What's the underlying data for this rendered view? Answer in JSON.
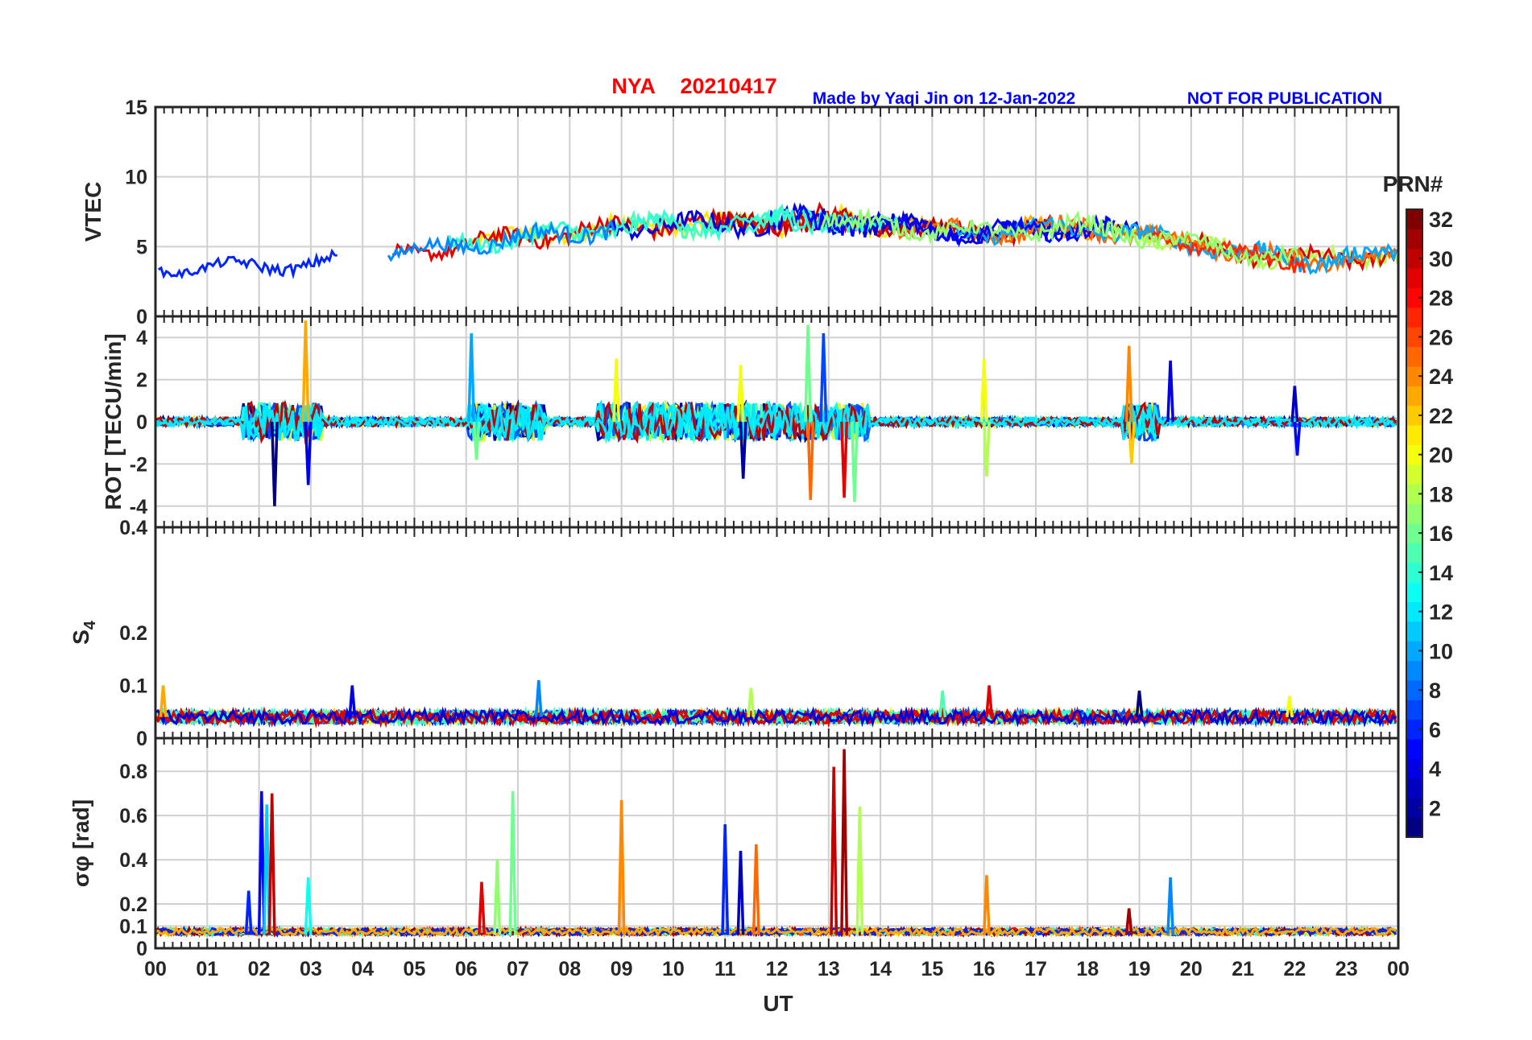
{
  "header": {
    "station": "NYA",
    "date": "20210417",
    "credit": "Made by Yaqi Jin on 12-Jan-2022",
    "notice": "NOT FOR PUBLICATION"
  },
  "x_axis": {
    "label": "UT",
    "ticks": [
      "00",
      "01",
      "02",
      "03",
      "04",
      "05",
      "06",
      "07",
      "08",
      "09",
      "10",
      "11",
      "12",
      "13",
      "14",
      "15",
      "16",
      "17",
      "18",
      "19",
      "20",
      "21",
      "22",
      "23",
      "00"
    ]
  },
  "colorbar": {
    "title": "PRN#",
    "range": [
      1,
      32
    ],
    "ticks": [
      "2",
      "4",
      "6",
      "8",
      "10",
      "12",
      "14",
      "16",
      "18",
      "20",
      "22",
      "24",
      "26",
      "28",
      "30",
      "32"
    ],
    "colormap": "jet"
  },
  "chart_data": [
    {
      "type": "line",
      "panel": "vtec",
      "ylabel": "VTEC",
      "ylim": [
        0,
        15
      ],
      "yticks": [
        "0",
        "5",
        "10",
        "15"
      ],
      "xlim_hours": [
        0,
        24
      ],
      "grid": true,
      "series_envelope": {
        "x_hours": [
          0,
          1,
          2,
          3,
          4,
          5,
          6,
          7,
          8,
          9,
          10,
          11,
          12,
          13,
          14,
          15,
          16,
          17,
          18,
          19,
          20,
          21,
          22,
          23,
          24
        ],
        "mean": [
          3.4,
          3.5,
          3.6,
          3.8,
          4.2,
          4.6,
          5.2,
          5.6,
          6.0,
          6.4,
          6.6,
          6.6,
          6.8,
          6.9,
          6.6,
          6.2,
          6.0,
          6.2,
          6.4,
          5.8,
          5.2,
          4.6,
          4.0,
          4.2,
          4.5
        ],
        "spread": [
          0.6,
          0.6,
          0.8,
          0.8,
          0.8,
          0.8,
          1.0,
          1.2,
          1.2,
          1.2,
          1.2,
          1.3,
          1.4,
          1.6,
          1.2,
          1.0,
          1.0,
          1.2,
          1.3,
          1.2,
          1.0,
          1.0,
          1.2,
          1.2,
          1.2
        ]
      }
    },
    {
      "type": "line",
      "panel": "rot",
      "ylabel": "ROT [TECU/min]",
      "ylim": [
        -5,
        5
      ],
      "yticks": [
        "-4",
        "-2",
        "0",
        "2",
        "4"
      ],
      "xlim_hours": [
        0,
        24
      ],
      "grid": true,
      "spikes": [
        {
          "x": 2.3,
          "y": -4.0
        },
        {
          "x": 2.9,
          "y": 4.8
        },
        {
          "x": 2.95,
          "y": -3.0
        },
        {
          "x": 6.1,
          "y": 4.2
        },
        {
          "x": 6.2,
          "y": -1.8
        },
        {
          "x": 8.9,
          "y": 3.0
        },
        {
          "x": 11.3,
          "y": 2.7
        },
        {
          "x": 11.35,
          "y": -2.7
        },
        {
          "x": 12.6,
          "y": 4.6
        },
        {
          "x": 12.65,
          "y": -3.7
        },
        {
          "x": 12.9,
          "y": 4.2
        },
        {
          "x": 13.3,
          "y": -3.6
        },
        {
          "x": 13.5,
          "y": -3.8
        },
        {
          "x": 16.0,
          "y": 3.0
        },
        {
          "x": 16.05,
          "y": -2.6
        },
        {
          "x": 18.8,
          "y": 3.6
        },
        {
          "x": 18.85,
          "y": -2.0
        },
        {
          "x": 19.6,
          "y": 2.9
        },
        {
          "x": 22.0,
          "y": 1.7
        },
        {
          "x": 22.05,
          "y": -1.6
        }
      ]
    },
    {
      "type": "line",
      "panel": "s4",
      "ylabel": "S4",
      "ylim": [
        0,
        0.4
      ],
      "yticks": [
        "0",
        "0.1",
        "0.2",
        "0.4"
      ],
      "xlim_hours": [
        0,
        24
      ],
      "grid": false,
      "baseline": 0.04,
      "spikes": [
        {
          "x": 0.15,
          "y": 0.1
        },
        {
          "x": 3.8,
          "y": 0.1
        },
        {
          "x": 7.4,
          "y": 0.11
        },
        {
          "x": 11.5,
          "y": 0.095
        },
        {
          "x": 15.2,
          "y": 0.09
        },
        {
          "x": 16.1,
          "y": 0.1
        },
        {
          "x": 19.0,
          "y": 0.09
        },
        {
          "x": 21.9,
          "y": 0.08
        }
      ]
    },
    {
      "type": "line",
      "panel": "sigma_phi",
      "ylabel": "σφ [rad]",
      "ylim": [
        0,
        0.95
      ],
      "yticks": [
        "0",
        "0.1",
        "0.2",
        "0.4",
        "0.6",
        "0.8"
      ],
      "xlim_hours": [
        0,
        24
      ],
      "grid": true,
      "baseline": 0.06,
      "spikes": [
        {
          "x": 2.05,
          "y": 0.71,
          "prn": 5
        },
        {
          "x": 2.15,
          "y": 0.65,
          "prn": 11
        },
        {
          "x": 2.25,
          "y": 0.7,
          "prn": 30
        },
        {
          "x": 1.8,
          "y": 0.26,
          "prn": 6
        },
        {
          "x": 2.95,
          "y": 0.32,
          "prn": 13
        },
        {
          "x": 6.9,
          "y": 0.71,
          "prn": 16
        },
        {
          "x": 6.6,
          "y": 0.4,
          "prn": 17
        },
        {
          "x": 6.3,
          "y": 0.3,
          "prn": 29
        },
        {
          "x": 9.0,
          "y": 0.67,
          "prn": 24
        },
        {
          "x": 11.0,
          "y": 0.56,
          "prn": 6
        },
        {
          "x": 11.3,
          "y": 0.44,
          "prn": 3
        },
        {
          "x": 11.6,
          "y": 0.47,
          "prn": 25
        },
        {
          "x": 13.1,
          "y": 0.82,
          "prn": 30
        },
        {
          "x": 13.3,
          "y": 0.9,
          "prn": 31
        },
        {
          "x": 13.6,
          "y": 0.64,
          "prn": 18
        },
        {
          "x": 16.05,
          "y": 0.33,
          "prn": 24
        },
        {
          "x": 18.8,
          "y": 0.18,
          "prn": 31
        },
        {
          "x": 19.6,
          "y": 0.32,
          "prn": 9
        }
      ]
    }
  ]
}
